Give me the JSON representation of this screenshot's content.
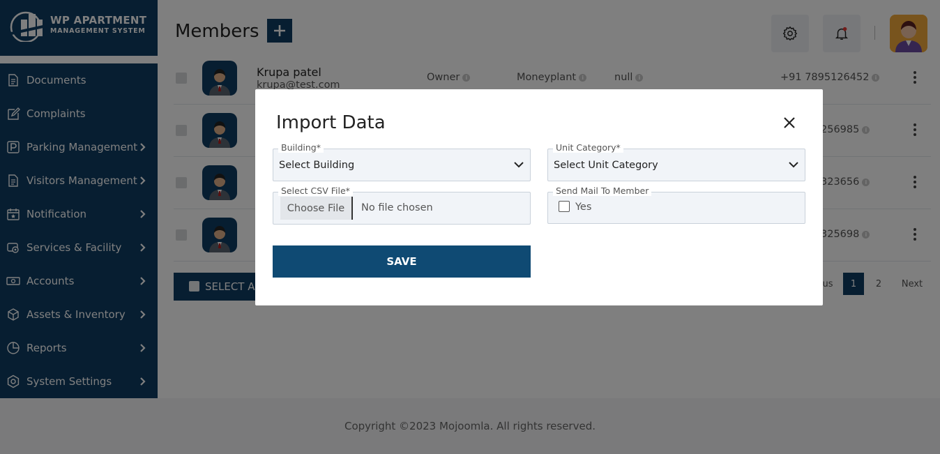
{
  "brand": {
    "title": "WP APARTMENT",
    "subtitle": "MANAGEMENT SYSTEM"
  },
  "sidebar": {
    "items": [
      {
        "label": "Documents",
        "icon": "document-icon",
        "has_arrow": false
      },
      {
        "label": "Complaints",
        "icon": "edit-icon",
        "has_arrow": false
      },
      {
        "label": "Parking Management",
        "icon": "parking-icon",
        "has_arrow": true
      },
      {
        "label": "Visitors Management",
        "icon": "visitor-icon",
        "has_arrow": true
      },
      {
        "label": "Notification",
        "icon": "calendar-icon",
        "has_arrow": true
      },
      {
        "label": "Services & Facility",
        "icon": "services-icon",
        "has_arrow": true
      },
      {
        "label": "Accounts",
        "icon": "money-icon",
        "has_arrow": true
      },
      {
        "label": "Assets & Inventory",
        "icon": "box-icon",
        "has_arrow": true
      },
      {
        "label": "Reports",
        "icon": "pie-chart-icon",
        "has_arrow": true
      },
      {
        "label": "System Settings",
        "icon": "gear-icon",
        "has_arrow": true
      }
    ]
  },
  "header": {
    "title": "Members",
    "add_label": "+"
  },
  "members": {
    "rows": [
      {
        "name": "Krupa patel",
        "email": "krupa@test.com",
        "role": "Owner",
        "building": "Moneyplant",
        "unit": "null",
        "phone": "+91 7895126452"
      },
      {
        "phone": "256985"
      },
      {
        "phone": "323656"
      },
      {
        "phone": "325698"
      }
    ],
    "select_all": "SELECT AL"
  },
  "pagination": {
    "prev": "ous",
    "pages": [
      "1",
      "2"
    ],
    "next": "Next"
  },
  "footer": {
    "copyright": "Copyright ©2023 Mojoomla. All rights reserved."
  },
  "modal": {
    "title": "Import Data",
    "building": {
      "label": "Building*",
      "value": "Select Building"
    },
    "unit_category": {
      "label": "Unit Category*",
      "value": "Select Unit Category"
    },
    "csv": {
      "label": "Select CSV File*",
      "button": "Choose File",
      "status": "No file chosen"
    },
    "send_mail": {
      "label": "Send Mail To Member",
      "option": "Yes"
    },
    "save": "SAVE"
  },
  "colors": {
    "primary": "#0f3d63",
    "button": "#0f4a73"
  }
}
